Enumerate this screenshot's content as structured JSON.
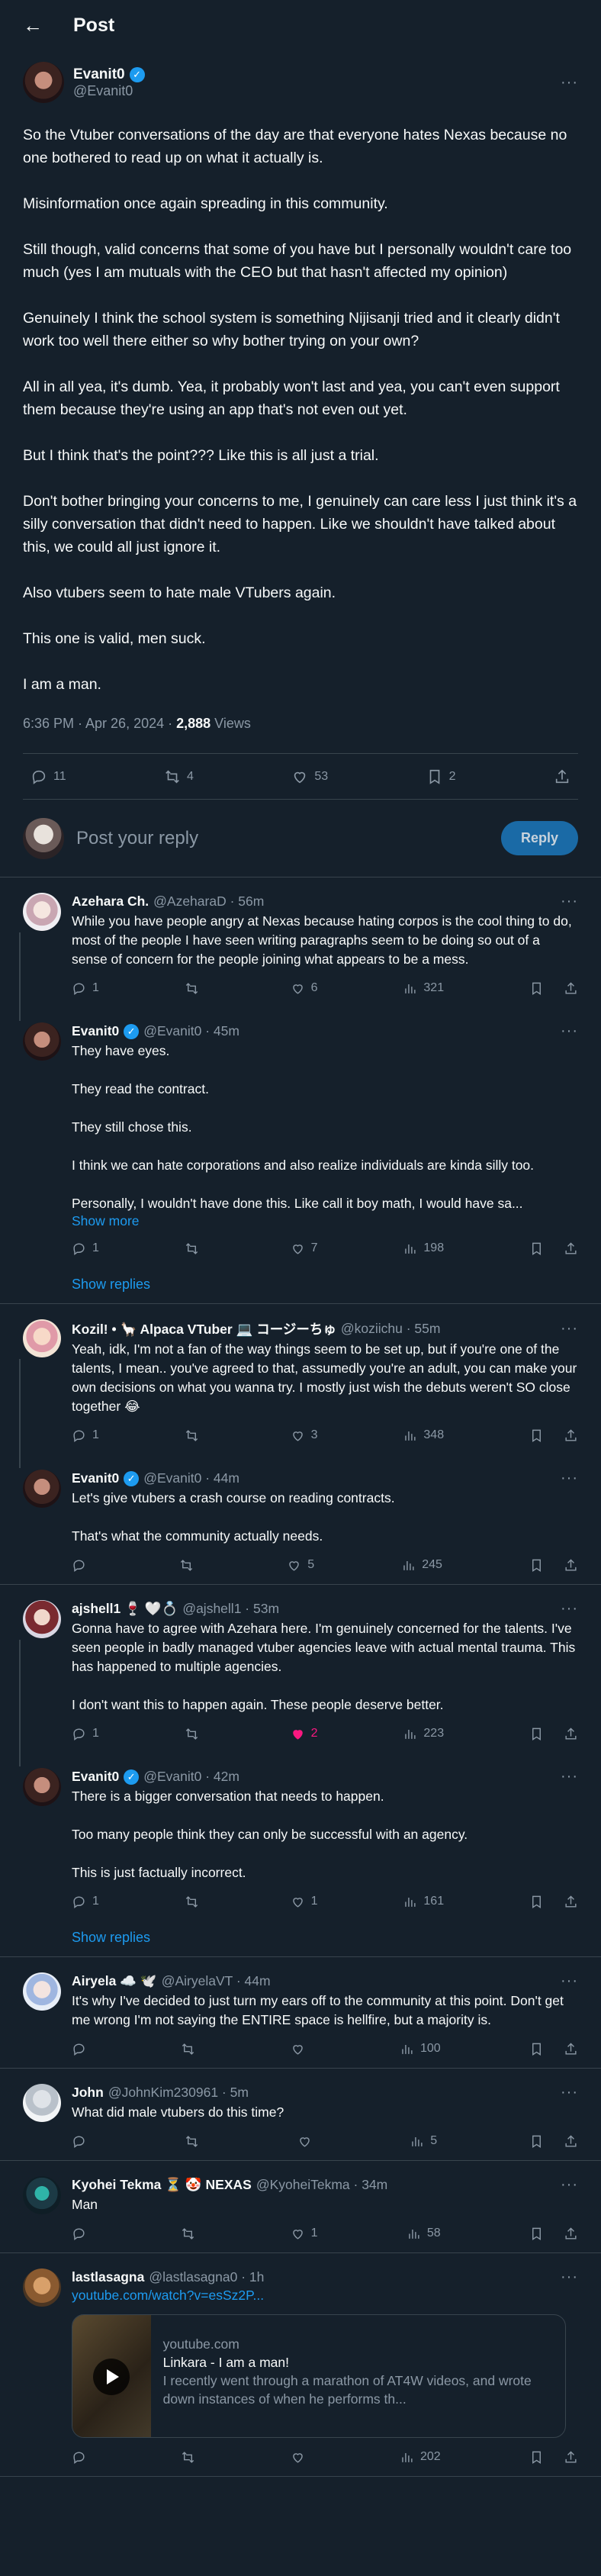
{
  "header": {
    "title": "Post",
    "back_icon": "arrow-left-icon"
  },
  "post": {
    "display_name": "Evanit0",
    "handle": "@Evanit0",
    "paragraphs": [
      "So the Vtuber conversations of the day are that everyone hates Nexas because no one bothered to read up on what it actually is.",
      "Misinformation once again spreading in this community.",
      "Still though, valid concerns that some of you have but I personally wouldn't care too much (yes I am mutuals with the CEO but that hasn't affected my opinion)",
      "Genuinely I think the school system is something Nijisanji tried and it clearly didn't work too well there either so why bother trying on your own?",
      "All in all yea, it's dumb. Yea, it probably won't last and yea, you can't even support them because they're using an app that's not even out yet.",
      "But I think that's the point??? Like this is all just a trial.",
      "Don't bother bringing your concerns to me, I genuinely can care less I just think it's a silly conversation that didn't need to happen. Like we shouldn't have talked about this, we could all just ignore it.",
      "Also vtubers seem to hate male VTubers again.",
      "This one is valid, men suck.",
      "I am a man."
    ],
    "time": "6:36 PM · Apr 26, 2024 · ",
    "views_count": "2,888",
    "views_label": " Views",
    "replies": "11",
    "reposts": "4",
    "likes": "53",
    "bookmarks": "2"
  },
  "compose": {
    "placeholder": "Post your reply",
    "button": "Reply"
  },
  "replies": [
    {
      "name": "Azehara Ch.",
      "handle": "@AzeharaD · 56m",
      "text": [
        "While you have people angry at Nexas because hating corpos is the cool thing to do, most of the people I have seen writing paragraphs seem to be doing so out of a sense of concern for the people joining what appears to be a mess."
      ],
      "replies": "1",
      "reposts": "",
      "likes": "6",
      "views": "321"
    },
    {
      "name": "Evanit0",
      "handle": "@Evanit0 · 45m",
      "text": [
        "They have eyes.",
        "They read the contract.",
        "They still chose this.",
        "I think we can hate corporations and also realize individuals are kinda silly too.",
        "Personally, I wouldn't have done this. Like call it boy math, I would have sa..."
      ],
      "show_more": "Show more",
      "replies": "1",
      "reposts": "",
      "likes": "7",
      "views": "198",
      "show_replies": "Show replies"
    },
    {
      "name": "Kozil! • 🦙 Alpaca VTuber 💻 コージーちゅ",
      "handle": "@koziichu · 55m",
      "text": [
        "Yeah, idk, I'm not a fan of the way things seem to be set up, but if you're one of the talents, I mean.. you've agreed to that, assumedly you're an adult, you can make your own decisions on what you wanna try. I mostly just wish the debuts weren't SO close together 😂"
      ],
      "replies": "1",
      "reposts": "",
      "likes": "3",
      "views": "348"
    },
    {
      "name": "Evanit0",
      "handle": "@Evanit0 · 44m",
      "text": [
        "Let's give vtubers a crash course on reading contracts.",
        "That's what the community actually needs."
      ],
      "replies": "",
      "reposts": "",
      "likes": "5",
      "views": "245"
    },
    {
      "name": "ajshell1 🍷 🤍💍",
      "handle": "@ajshell1 · 53m",
      "text": [
        "Gonna have to agree with Azehara here. I'm genuinely concerned for the talents. I've seen people in badly managed vtuber agencies leave with actual mental trauma. This has happened to multiple agencies.",
        "I don't want this to happen again. These people deserve better."
      ],
      "replies": "1",
      "reposts": "",
      "likes": "2",
      "views": "223"
    },
    {
      "name": "Evanit0",
      "handle": "@Evanit0 · 42m",
      "text": [
        "There is a bigger conversation that needs to happen.",
        "Too many people think they can only be successful with an agency.",
        "This is just factually incorrect."
      ],
      "replies": "1",
      "reposts": "",
      "likes": "1",
      "views": "161",
      "show_replies": "Show replies"
    },
    {
      "name": "Airyela ☁️ 🕊️",
      "handle": "@AiryelaVT · 44m",
      "text": [
        "It's why I've decided to just turn my ears off to the community at this point. Don't get me wrong I'm not saying the ENTIRE space is hellfire, but a majority is."
      ],
      "replies": "",
      "reposts": "",
      "likes": "",
      "views": "100"
    },
    {
      "name": "John",
      "handle": "@JohnKim230961 · 5m",
      "text": [
        "What did male vtubers do this time?"
      ],
      "replies": "",
      "reposts": "",
      "likes": "",
      "views": "5"
    },
    {
      "name": "Kyohei Tekma ⏳ 🤡 NEXAS",
      "handle": "@KyoheiTekma · 34m",
      "text": [
        "Man"
      ],
      "replies": "",
      "reposts": "",
      "likes": "1",
      "views": "58"
    },
    {
      "name": "lastlasagna",
      "handle": "@lastlasagna0 · 1h",
      "link": "youtube.com/watch?v=esSz2P...",
      "card": {
        "domain": "youtube.com",
        "title": "Linkara - I am a man!",
        "desc": "I recently went through a marathon of AT4W videos, and wrote down instances of when he performs th..."
      },
      "replies": "",
      "reposts": "",
      "likes": "",
      "views": "202"
    }
  ],
  "colors": {
    "background": "#15202b",
    "accent": "#1d9bf0",
    "like": "#f91880",
    "muted": "#8b98a5",
    "border": "#38444d"
  }
}
